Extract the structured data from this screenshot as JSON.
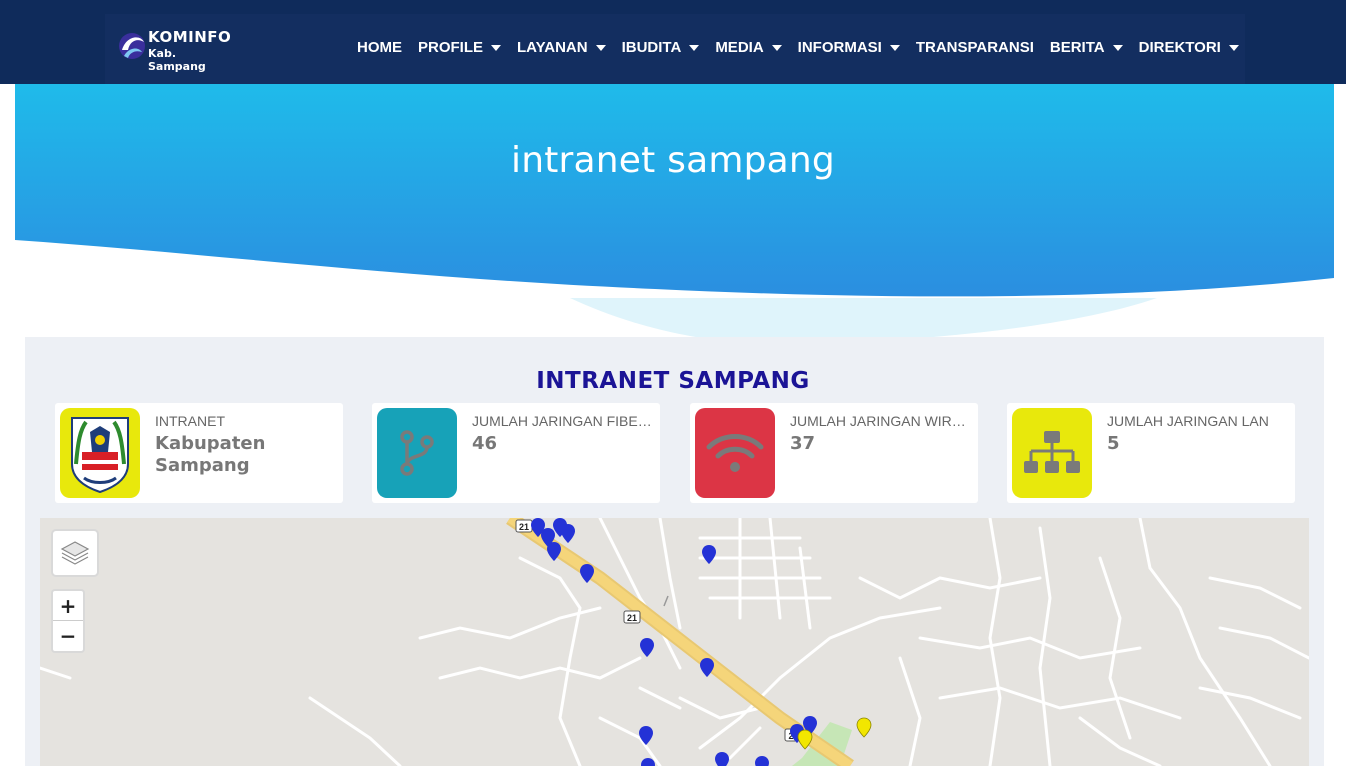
{
  "header": {
    "logo": {
      "line1": "KOMINFO",
      "line2": "Kab. Sampang"
    },
    "nav": [
      {
        "label": "HOME",
        "dropdown": false
      },
      {
        "label": "PROFILE",
        "dropdown": true
      },
      {
        "label": "LAYANAN",
        "dropdown": true
      },
      {
        "label": "IBUDITA",
        "dropdown": true
      },
      {
        "label": "MEDIA",
        "dropdown": true
      },
      {
        "label": "INFORMASI",
        "dropdown": true
      },
      {
        "label": "TRANSPARANSI",
        "dropdown": false
      },
      {
        "label": "BERITA",
        "dropdown": true
      },
      {
        "label": "DIREKTORI",
        "dropdown": true
      }
    ]
  },
  "hero": {
    "title": "intranet sampang"
  },
  "section": {
    "title": "INTRANET SAMPANG"
  },
  "cards": [
    {
      "label": "INTRANET",
      "value": "Kabupaten Sampang",
      "icon": "sampang-emblem-icon",
      "color": "#e8e80c"
    },
    {
      "label": "JUMLAH JARINGAN FIBER OPTIK",
      "value": "46",
      "icon": "fiber-branch-icon",
      "color": "#17a2b8"
    },
    {
      "label": "JUMLAH JARINGAN WIRELESS",
      "value": "37",
      "icon": "wifi-icon",
      "color": "#dc3545"
    },
    {
      "label": "JUMLAH JARINGAN LAN",
      "value": "5",
      "icon": "network-tree-icon",
      "color": "#e8e80c"
    }
  ],
  "map": {
    "road_labels": [
      "21",
      "21",
      "2"
    ],
    "zoom_in": "+",
    "zoom_out": "−",
    "colors": {
      "background": "#e5e3df",
      "road": "#ffffff",
      "highway": "#f5d57a",
      "marker_blue": "#2432d6",
      "marker_yellow": "#f2e600",
      "park": "#c6e6b6"
    }
  },
  "colors": {
    "header": "#0f2b5b",
    "hero_top": "#1fbbea",
    "hero_bottom": "#2b8ee0",
    "section_title": "#1b1496",
    "panel": "#edf0f5"
  }
}
